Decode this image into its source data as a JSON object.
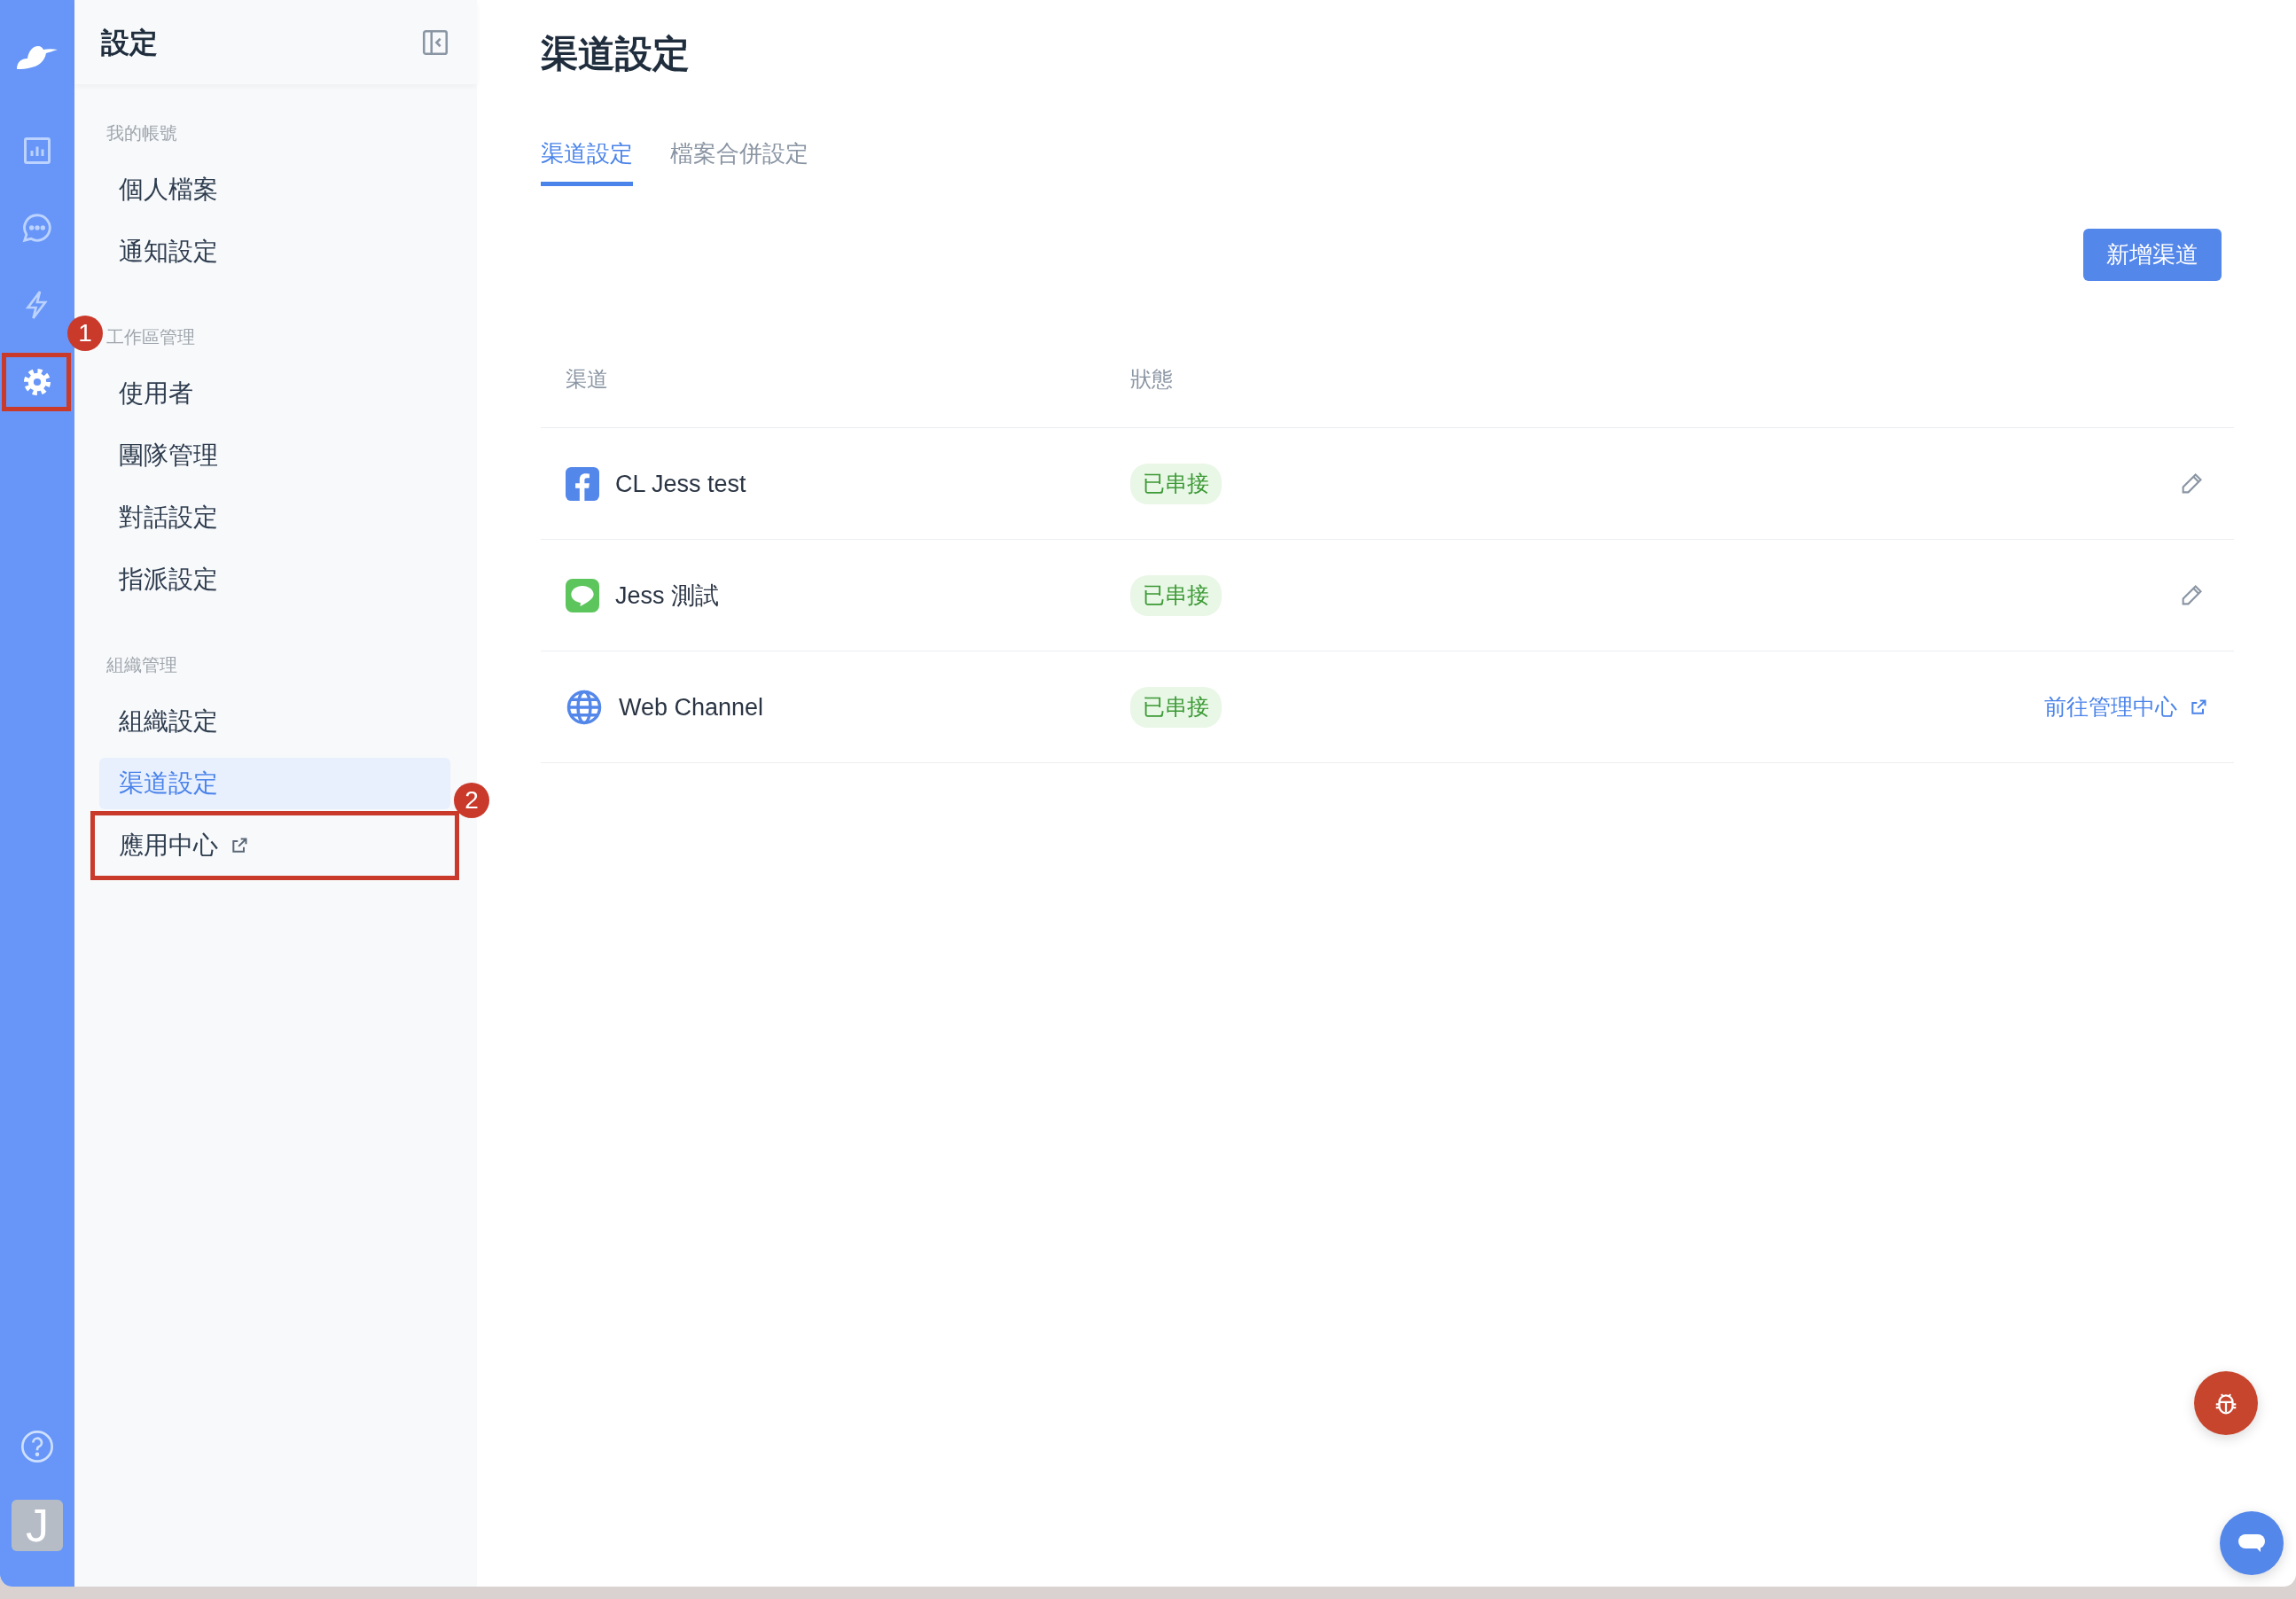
{
  "rail": {
    "items": [
      {
        "kind": "chart",
        "selected": false
      },
      {
        "kind": "chat",
        "selected": false
      },
      {
        "kind": "bolt",
        "selected": false
      },
      {
        "kind": "settings",
        "selected": true,
        "annotation": "1"
      }
    ],
    "avatar": "J"
  },
  "sidebar": {
    "title": "設定",
    "sections": [
      {
        "heading": "我的帳號",
        "items": [
          {
            "label": "個人檔案",
            "selected": false,
            "external": false
          },
          {
            "label": "通知設定",
            "selected": false,
            "external": false
          }
        ]
      },
      {
        "heading": "工作區管理",
        "items": [
          {
            "label": "使用者",
            "selected": false,
            "external": false
          },
          {
            "label": "團隊管理",
            "selected": false,
            "external": false
          },
          {
            "label": "對話設定",
            "selected": false,
            "external": false
          },
          {
            "label": "指派設定",
            "selected": false,
            "external": false
          }
        ]
      },
      {
        "heading": "組織管理",
        "items": [
          {
            "label": "組織設定",
            "selected": false,
            "external": false
          },
          {
            "label": "渠道設定",
            "selected": true,
            "external": false
          },
          {
            "label": "應用中心",
            "selected": false,
            "external": true,
            "annotation": "2"
          }
        ]
      }
    ]
  },
  "main": {
    "title": "渠道設定",
    "tabs": [
      {
        "label": "渠道設定",
        "selected": true
      },
      {
        "label": "檔案合併設定",
        "selected": false
      }
    ],
    "add_button": "新增渠道",
    "table": {
      "columns": [
        "渠道",
        "狀態"
      ],
      "rows": [
        {
          "kind": "facebook",
          "name": "CL Jess test",
          "status": "已串接",
          "action": {
            "kind": "edit"
          }
        },
        {
          "kind": "line",
          "name": "Jess 測試",
          "status": "已串接",
          "action": {
            "kind": "edit"
          }
        },
        {
          "kind": "web",
          "name": "Web Channel",
          "status": "已串接",
          "action": {
            "kind": "link",
            "label": "前往管理中心"
          }
        }
      ]
    }
  },
  "floating_buttons": [
    {
      "kind": "bug"
    },
    {
      "kind": "chat"
    }
  ]
}
